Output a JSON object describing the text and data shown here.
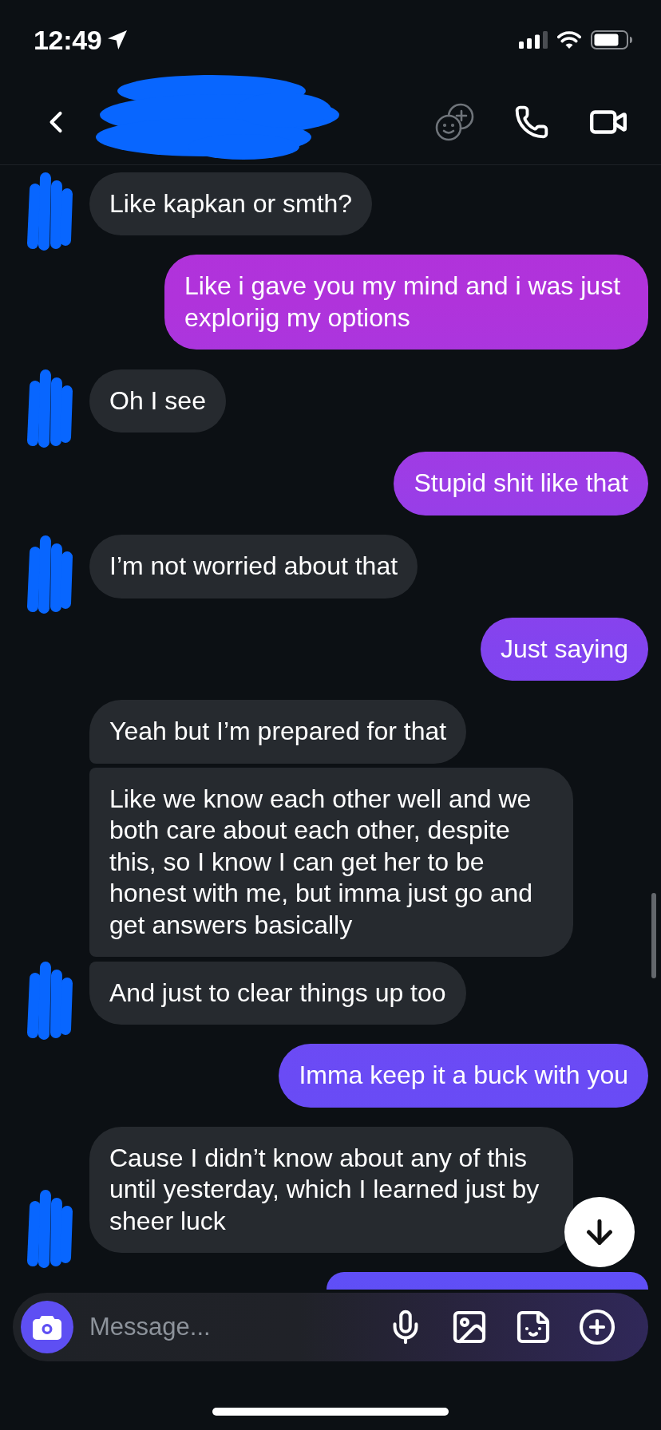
{
  "status_bar": {
    "time": "12:49"
  },
  "messages": [
    {
      "kind": "received",
      "text": "Like kapkan or smth?"
    },
    {
      "kind": "sent",
      "text": "Like i gave you my mind and i was just explorijg my options"
    },
    {
      "kind": "received",
      "text": "Oh I see"
    },
    {
      "kind": "sent",
      "text": "Stupid shit like that"
    },
    {
      "kind": "received",
      "text": "I’m not worried about that"
    },
    {
      "kind": "sent",
      "text": "Just saying"
    },
    {
      "kind": "received",
      "text": "Yeah but I’m prepared for that"
    },
    {
      "kind": "received",
      "text": "Like we know each other well and we both care about each other, despite this, so I know I can get her to be honest with me, but imma just go and get answers basically"
    },
    {
      "kind": "received",
      "text": "And just to clear things up too"
    },
    {
      "kind": "sent",
      "text": "Imma keep it a buck with you"
    },
    {
      "kind": "received",
      "text": "Cause I didn’t know about any of this until yesterday, which I learned just by sheer luck"
    },
    {
      "kind": "sent"
    }
  ],
  "composer": {
    "placeholder": "Message..."
  }
}
